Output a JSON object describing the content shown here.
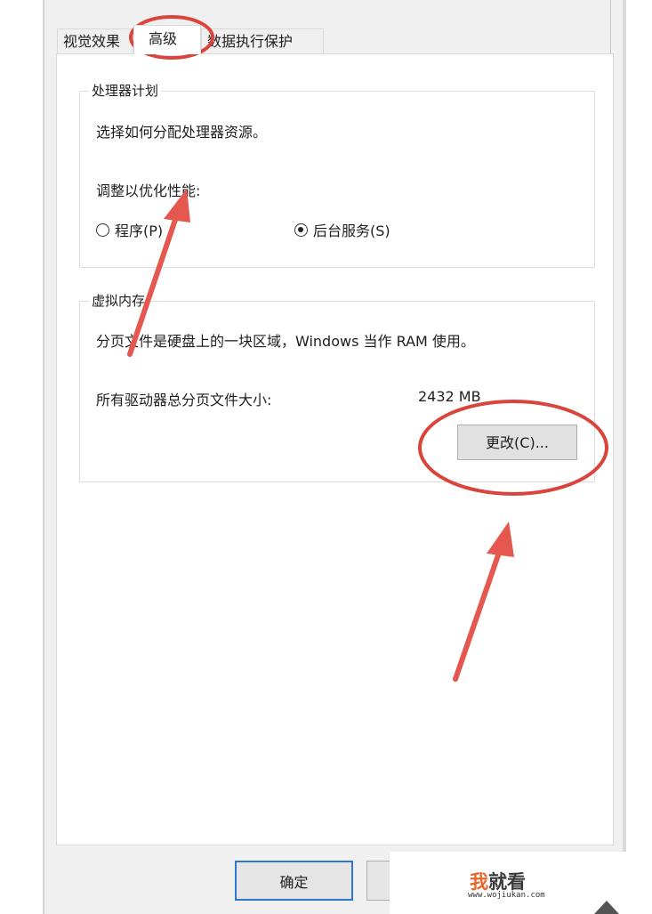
{
  "tabs": [
    {
      "label": "视觉效果"
    },
    {
      "label": "高级"
    },
    {
      "label": "数据执行保护"
    }
  ],
  "processor_group": {
    "legend": "处理器计划",
    "description": "选择如何分配处理器资源。",
    "adjust_label": "调整以优化性能:",
    "options": [
      {
        "label": "程序(P)",
        "selected": false
      },
      {
        "label": "后台服务(S)",
        "selected": true
      }
    ]
  },
  "virtual_memory_group": {
    "legend": "虚拟内存",
    "description": "分页文件是硬盘上的一块区域，Windows 当作 RAM 使用。",
    "total_label": "所有驱动器总分页文件大小:",
    "total_value": "2432 MB",
    "change_button": "更改(C)..."
  },
  "footer": {
    "ok_button": "确定"
  },
  "watermark": {
    "wo": "我",
    "rest": "就看",
    "url": "www.wojiukan.com"
  },
  "annotation_colors": {
    "highlight": "#d9453d"
  }
}
